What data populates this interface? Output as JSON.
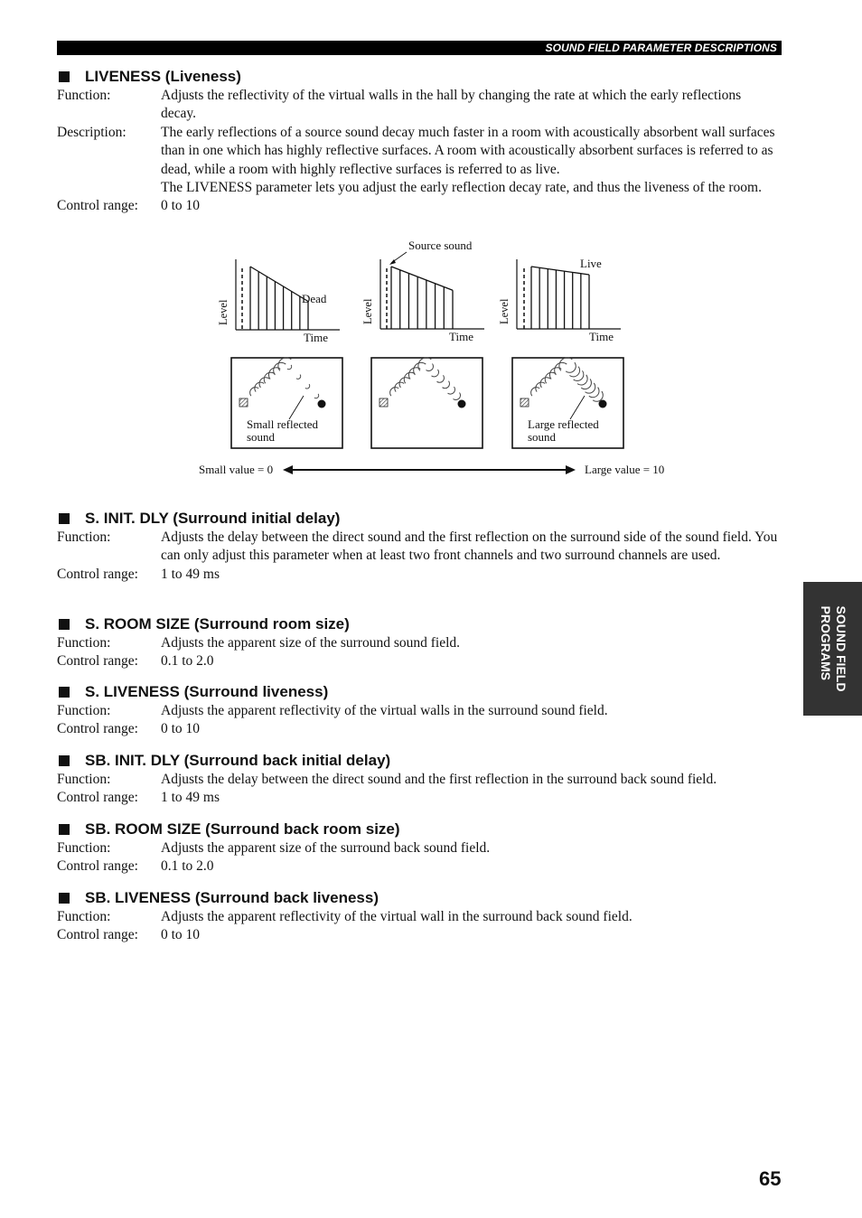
{
  "header": {
    "title": "SOUND FIELD PARAMETER DESCRIPTIONS"
  },
  "side_tab": {
    "line1": "SOUND FIELD",
    "line2": "PROGRAMS"
  },
  "page_number": "65",
  "labels": {
    "function": "Function:",
    "description": "Description:",
    "control_range": "Control range:"
  },
  "sections": [
    {
      "title": "LIVENESS (Liveness)",
      "function": "Adjusts the reflectivity of the virtual walls in the hall by changing the rate at which the early reflections decay.",
      "description": [
        "The early reflections of a source sound decay much faster in a room with acoustically absorbent wall surfaces than in one which has highly reflective surfaces. A room with acoustically absorbent surfaces is referred to as dead, while a room with highly reflective surfaces is referred to as live.",
        "The LIVENESS parameter lets you adjust the early reflection decay rate, and thus the liveness of the room."
      ],
      "control_range": "0 to 10"
    },
    {
      "title": "S. INIT. DLY (Surround initial delay)",
      "function": "Adjusts the delay between the direct sound and the first reflection on the surround side of the sound field. You can only adjust this parameter when at least two front channels and two surround channels are used.",
      "control_range": "1 to 49 ms"
    },
    {
      "title": "S. ROOM SIZE (Surround room size)",
      "function": "Adjusts the apparent size of the surround sound field.",
      "control_range": "0.1 to 2.0"
    },
    {
      "title": "S. LIVENESS (Surround liveness)",
      "function": "Adjusts the apparent reflectivity of the virtual walls in the surround sound field.",
      "control_range": "0 to 10"
    },
    {
      "title": "SB. INIT. DLY (Surround back initial delay)",
      "function": "Adjusts the delay between the direct sound and the first reflection in the surround back sound field.",
      "control_range": "1 to 49 ms"
    },
    {
      "title": "SB. ROOM SIZE (Surround back room size)",
      "function": "Adjusts the apparent size of the surround back sound field.",
      "control_range": "0.1 to 2.0"
    },
    {
      "title": "SB. LIVENESS (Surround back liveness)",
      "function": "Adjusts the apparent reflectivity of the virtual wall in the surround back sound field.",
      "control_range": "0 to 10"
    }
  ],
  "diagram": {
    "axis_level": "Level",
    "axis_time": "Time",
    "source_sound_label": "Source sound",
    "graphs": [
      {
        "name": "dead",
        "label": "Dead",
        "reflections": 8,
        "start_level": 1.0,
        "end_level": 0.45
      },
      {
        "name": "middle",
        "label": "",
        "reflections": 8,
        "start_level": 1.0,
        "end_level": 0.62
      },
      {
        "name": "live",
        "label": "Live",
        "reflections": 8,
        "start_level": 1.0,
        "end_level": 0.87
      }
    ],
    "rooms": [
      {
        "name": "small",
        "caption_line1": "Small reflected",
        "caption_line2": "sound"
      },
      {
        "name": "medium",
        "caption_line1": "",
        "caption_line2": ""
      },
      {
        "name": "large",
        "caption_line1": "Large reflected",
        "caption_line2": "sound"
      }
    ],
    "scale_min_label": "Small value = 0",
    "scale_max_label": "Large value = 10"
  }
}
